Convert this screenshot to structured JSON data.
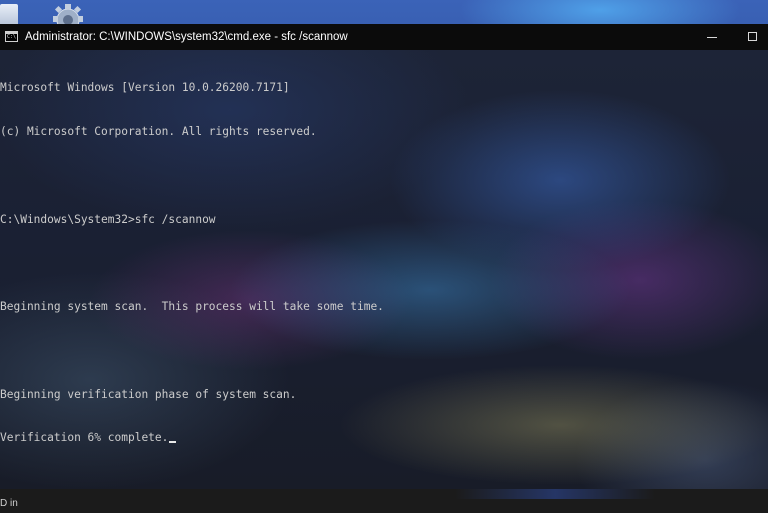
{
  "window": {
    "title": "Administrator: C:\\WINDOWS\\system32\\cmd.exe - sfc  /scannow",
    "app_icon": "cmd-icon",
    "app_icon_label": "C:\\",
    "controls": {
      "minimize": "minimize-icon",
      "maximize": "maximize-icon"
    }
  },
  "console": {
    "lines": [
      "Microsoft Windows [Version 10.0.26200.7171]",
      "(c) Microsoft Corporation. All rights reserved.",
      "",
      "C:\\Windows\\System32>sfc /scannow",
      "",
      "Beginning system scan.  This process will take some time.",
      "",
      "Beginning verification phase of system scan.",
      "Verification 6% complete."
    ],
    "progress_percent": 6,
    "text_color": "#cccccc"
  },
  "desktop": {
    "icon": "settings-gear-icon",
    "icon_left": "document-icon"
  },
  "taskbar": {
    "text": "D in"
  }
}
